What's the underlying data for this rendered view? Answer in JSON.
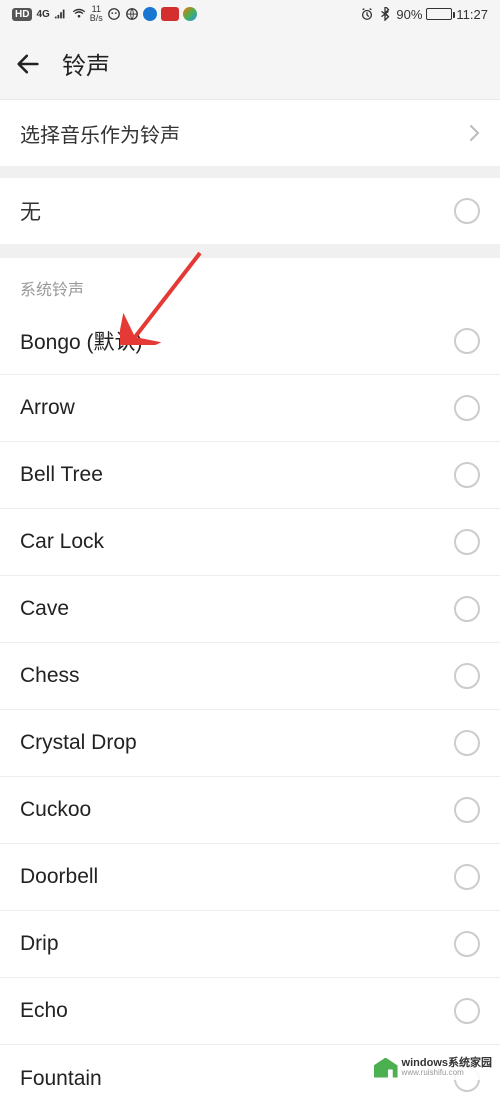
{
  "status": {
    "hd": "HD",
    "net": "4G",
    "speed_num": "11",
    "speed_unit": "B/s",
    "battery_pct": "90%",
    "time": "11:27"
  },
  "header": {
    "title": "铃声"
  },
  "music_row": {
    "label": "选择音乐作为铃声"
  },
  "none_row": {
    "label": "无"
  },
  "system_section": {
    "title": "系统铃声",
    "items": [
      {
        "label": "Bongo (默认)"
      },
      {
        "label": "Arrow"
      },
      {
        "label": "Bell Tree"
      },
      {
        "label": "Car Lock"
      },
      {
        "label": "Cave"
      },
      {
        "label": "Chess"
      },
      {
        "label": "Crystal Drop"
      },
      {
        "label": "Cuckoo"
      },
      {
        "label": "Doorbell"
      },
      {
        "label": "Drip"
      },
      {
        "label": "Echo"
      },
      {
        "label": "Fountain"
      }
    ]
  },
  "watermark": {
    "main": "windows系统家园",
    "sub": "www.ruishifu.com"
  }
}
